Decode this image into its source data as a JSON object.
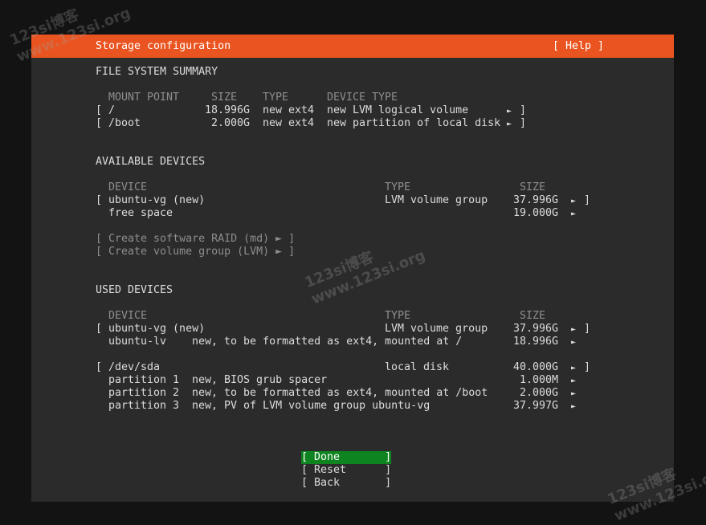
{
  "title": "Storage configuration",
  "help_label": "[ Help ]",
  "fs_summary": {
    "heading": "FILE SYSTEM SUMMARY",
    "columns": [
      "MOUNT POINT",
      "SIZE",
      "TYPE",
      "DEVICE TYPE"
    ],
    "rows": [
      {
        "bracket": "[",
        "mount": "/",
        "size": "18.996G",
        "type": "new ext4",
        "device_type": "new LVM logical volume",
        "arrow": "►",
        "close": "]"
      },
      {
        "bracket": "[",
        "mount": "/boot",
        "size": "2.000G",
        "type": "new ext4",
        "device_type": "new partition of local disk",
        "arrow": "►",
        "close": "]"
      }
    ]
  },
  "available": {
    "heading": "AVAILABLE DEVICES",
    "columns": [
      "DEVICE",
      "TYPE",
      "SIZE"
    ],
    "rows": [
      {
        "bracket": "[",
        "device": "ubuntu-vg (new)",
        "type": "LVM volume group",
        "size": "37.996G",
        "arrow": "►",
        "close": "]"
      },
      {
        "device": "free space",
        "size": "19.000G",
        "arrow": "►"
      }
    ],
    "actions": [
      "[ Create software RAID (md) ► ]",
      "[ Create volume group (LVM) ► ]"
    ]
  },
  "used": {
    "heading": "USED DEVICES",
    "columns": [
      "DEVICE",
      "TYPE",
      "SIZE"
    ],
    "groups": [
      {
        "header": {
          "bracket": "[",
          "device": "ubuntu-vg (new)",
          "type": "LVM volume group",
          "size": "37.996G",
          "arrow": "►",
          "close": "]"
        },
        "children": [
          {
            "name": "ubuntu-lv",
            "desc": "new, to be formatted as ext4, mounted at /",
            "size": "18.996G",
            "arrow": "►"
          }
        ]
      },
      {
        "header": {
          "bracket": "[",
          "device": "/dev/sda",
          "type": "local disk",
          "size": "40.000G",
          "arrow": "►",
          "close": "]"
        },
        "children": [
          {
            "name": "partition 1",
            "desc": "new, BIOS grub spacer",
            "size": "1.000M",
            "arrow": "►"
          },
          {
            "name": "partition 2",
            "desc": "new, to be formatted as ext4, mounted at /boot",
            "size": "2.000G",
            "arrow": "►"
          },
          {
            "name": "partition 3",
            "desc": "new, PV of LVM volume group ubuntu-vg",
            "size": "37.997G",
            "arrow": "►"
          }
        ]
      }
    ]
  },
  "buttons": {
    "done": "[ Done       ]",
    "reset": "[ Reset      ]",
    "back": "[ Back       ]"
  },
  "watermarks": {
    "top_left": "123si博客\nwww.123si.org",
    "center": "123si博客\nwww.123si.org",
    "bottom_right": "123si博客\nwww.123si.org"
  },
  "colors": {
    "accent": "#e95420",
    "done_button": "#0e8420",
    "background": "#2b2b2b"
  }
}
